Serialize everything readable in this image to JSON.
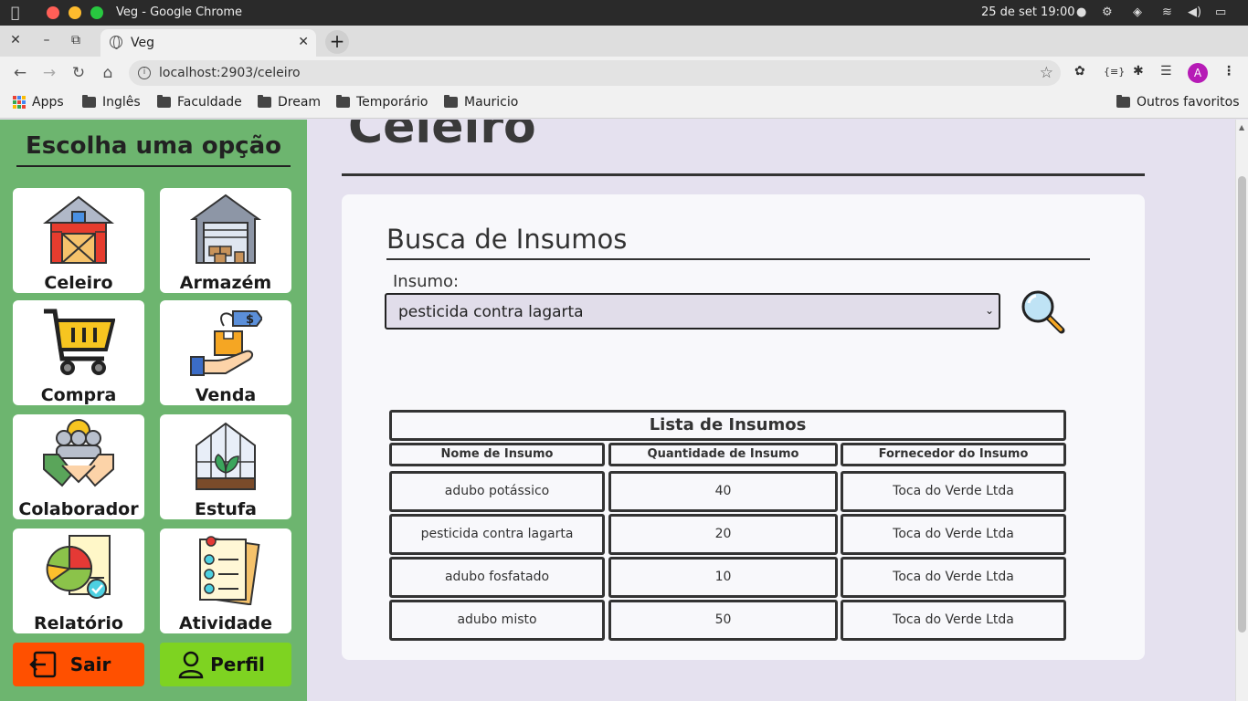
{
  "os": {
    "window_title": "Veg - Google Chrome",
    "clock": "25 de set  19:00"
  },
  "browser": {
    "tab_title": "Veg",
    "url": "localhost:2903/celeiro",
    "profile_initial": "A",
    "bookmarks": [
      {
        "label": "Apps",
        "icon": "apps-grid-icon"
      },
      {
        "label": "Inglês",
        "icon": "folder-icon"
      },
      {
        "label": "Faculdade",
        "icon": "folder-icon"
      },
      {
        "label": "Dream",
        "icon": "folder-icon"
      },
      {
        "label": "Temporário",
        "icon": "folder-icon"
      },
      {
        "label": "Mauricio",
        "icon": "folder-icon"
      }
    ],
    "other_bookmarks": "Outros favoritos"
  },
  "sidebar": {
    "title": "Escolha uma opção",
    "items": [
      {
        "label": "Celeiro",
        "icon": "barn-icon"
      },
      {
        "label": "Armazém",
        "icon": "warehouse-icon"
      },
      {
        "label": "Compra",
        "icon": "shopping-cart-icon"
      },
      {
        "label": "Venda",
        "icon": "sale-hand-icon"
      },
      {
        "label": "Colaborador",
        "icon": "handshake-team-icon"
      },
      {
        "label": "Estufa",
        "icon": "greenhouse-icon"
      },
      {
        "label": "Relatório",
        "icon": "report-chart-icon"
      },
      {
        "label": "Atividade",
        "icon": "checklist-icon"
      }
    ],
    "logout_label": "Sair",
    "profile_label": "Perfil",
    "colors": {
      "background": "#6db56f",
      "logout": "#ff5000",
      "profile": "#7ed321"
    }
  },
  "main": {
    "page_title": "Celeiro",
    "panel_title": "Busca de Insumos",
    "field_label": "Insumo:",
    "selected_insumo": "pesticida contra lagarta",
    "table": {
      "caption": "Lista de Insumos",
      "headers": [
        "Nome de Insumo",
        "Quantidade de Insumo",
        "Fornecedor do Insumo"
      ],
      "rows": [
        [
          "adubo potássico",
          "40",
          "Toca do Verde Ltda"
        ],
        [
          "pesticida contra lagarta",
          "20",
          "Toca do Verde Ltda"
        ],
        [
          "adubo fosfatado",
          "10",
          "Toca do Verde Ltda"
        ],
        [
          "adubo misto",
          "50",
          "Toca do Verde Ltda"
        ]
      ]
    }
  }
}
